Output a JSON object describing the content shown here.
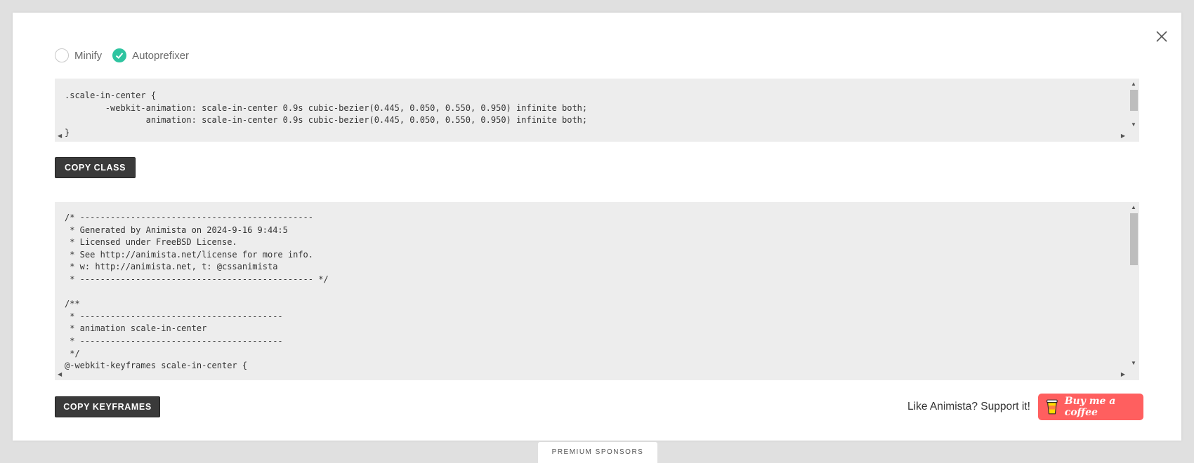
{
  "options": {
    "minify": {
      "label": "Minify",
      "checked": false
    },
    "autoprefixer": {
      "label": "Autoprefixer",
      "checked": true
    }
  },
  "class_code": ".scale-in-center {\n        -webkit-animation: scale-in-center 0.9s cubic-bezier(0.445, 0.050, 0.550, 0.950) infinite both;\n                animation: scale-in-center 0.9s cubic-bezier(0.445, 0.050, 0.550, 0.950) infinite both;\n}",
  "copy_class_label": "COPY CLASS",
  "keyframes_code": "/* ----------------------------------------------\n * Generated by Animista on 2024-9-16 9:44:5\n * Licensed under FreeBSD License.\n * See http://animista.net/license for more info.\n * w: http://animista.net, t: @cssanimista\n * ---------------------------------------------- */\n\n/**\n * ----------------------------------------\n * animation scale-in-center\n * ----------------------------------------\n */\n@-webkit-keyframes scale-in-center {",
  "copy_keyframes_label": "COPY KEYFRAMES",
  "support": {
    "text": "Like Animista? Support it!",
    "button_label": "Buy me a coffee"
  },
  "sponsors_label": "PREMIUM SPONSORS",
  "colors": {
    "accent": "#2ec4a0",
    "coffee": "#ff5f5f",
    "button": "#3a3a3a",
    "code_bg": "#ededed"
  }
}
